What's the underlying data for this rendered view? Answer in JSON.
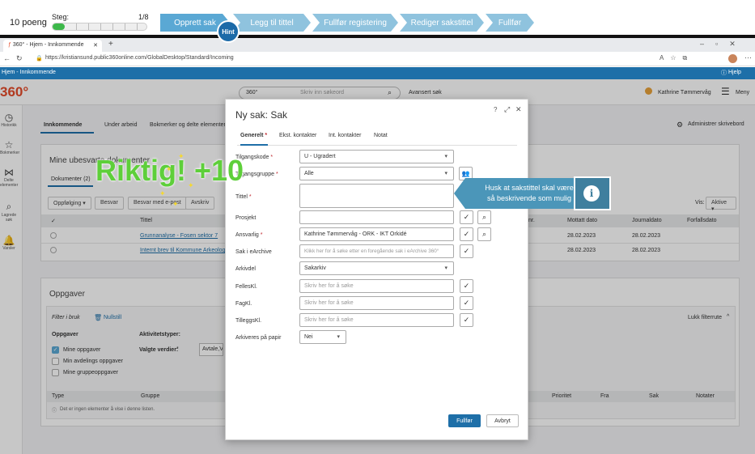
{
  "tutorial": {
    "score": "10 poeng",
    "step_label": "Steg:",
    "step_count": "1/8",
    "progress_fraction": 0.125,
    "steps": [
      "Opprett sak",
      "Legg til tittel",
      "Fullfør registering",
      "Rediger sakstittel",
      "Fullfør"
    ],
    "hint_label": "Hint"
  },
  "browser": {
    "tab_title": "360° - Hjem - Innkommende",
    "url": "https://kristiansund.public360online.com/GlobalDesktop/Standard/Incoming"
  },
  "app": {
    "breadcrumb": "Hjem - Innkommende",
    "help_label": "Hjelp",
    "logo": "360°",
    "search_scope": "360°",
    "search_placeholder": "Skriv inn søkeord",
    "advanced_search": "Avansert søk",
    "user_name": "Kathrine Tømmervåg",
    "menu_label": "Meny",
    "nav": [
      "Historikk",
      "Bokmerker",
      "Delte elementer",
      "Lagrede søk",
      "Varsler"
    ]
  },
  "background": {
    "tabs": [
      "Innkommende",
      "Under arbeid",
      "Bokmerker og delte elementer"
    ],
    "manage_desk": "Administrer skrivebord",
    "section_title": "Mine ubesvarte dokumenter",
    "doc_tab": "Dokumenter (2)",
    "toolbar": [
      "Oppfølging",
      "Besvar",
      "Besvar med e-post",
      "Avskriv"
    ],
    "view_label": "Vis:",
    "view_value": "Aktive",
    "columns": [
      "Tittel",
      "nr.",
      "Mottatt dato",
      "Journaldato",
      "Forfallsdato"
    ],
    "rows": [
      {
        "title": "Grunnanalyse - Fosen sektor 7",
        "received": "28.02.2023",
        "journal": "28.02.2023"
      },
      {
        "title": "Internt brev til Kommune Arkeologi",
        "received": "28.02.2023",
        "journal": "28.02.2023"
      }
    ],
    "tasks_title": "Oppgaver",
    "filter_label": "Filter i bruk",
    "reset_label": "Nullstill",
    "collapse_label": "Lukk filterrute",
    "tasks_head": "Oppgaver",
    "task_options": [
      "Mine oppgaver",
      "Min avdelings oppgaver",
      "Mine gruppeoppgaver"
    ],
    "activity_label": "Aktivitetstyper:",
    "values_label": "Valgte verdier:",
    "values_value": "Avtale,Vu",
    "task_columns": [
      "Type",
      "Gruppe",
      "Prioritet",
      "Fra",
      "Sak",
      "Notater"
    ],
    "empty_text": "Det er ingen elementer å vise i denne listen."
  },
  "modal": {
    "title": "Ny sak: Sak",
    "tabs": [
      "Generelt",
      "Ekst. kontakter",
      "Int. kontakter",
      "Notat"
    ],
    "fields": {
      "tilgangskode": {
        "label": "Tilgangskode",
        "value": "U - Ugradert"
      },
      "tilgangsgruppe": {
        "label": "Tilgangsgruppe",
        "value": "Alle"
      },
      "tittel": {
        "label": "Tittel",
        "value": ""
      },
      "prosjekt": {
        "label": "Prosjekt",
        "value": ""
      },
      "ansvarlig": {
        "label": "Ansvarlig",
        "value": "Kathrine Tømmervåg - ORK - IKT Orkidé"
      },
      "sak_earchive": {
        "label": "Sak i eArchive",
        "placeholder": "Klikk her for å søke etter en foregående sak i eArchive 360°"
      },
      "arkivdel": {
        "label": "Arkivdel",
        "value": "Sakarkiv"
      },
      "felleskl": {
        "label": "FellesKl.",
        "placeholder": "Skriv her for å søke"
      },
      "fagkl": {
        "label": "FagKl.",
        "placeholder": "Skriv her for å søke"
      },
      "tilleggskl": {
        "label": "TilleggsKl.",
        "placeholder": "Skriv her for å søke"
      },
      "arkiveres_papir": {
        "label": "Arkiveres på papir",
        "value": "Nei"
      }
    },
    "finish_label": "Fullfør",
    "cancel_label": "Avbryt"
  },
  "callout": {
    "text_line1": "Husk at sakstittel skal være",
    "text_line2": "så beskrivende som mulig",
    "icon": "i"
  },
  "feedback": {
    "text": "Riktig! +10"
  },
  "colors": {
    "accent": "#1e6fa8",
    "chevron": "#8fc3de",
    "success": "#5ecf3a",
    "logo": "#e44b2a"
  }
}
